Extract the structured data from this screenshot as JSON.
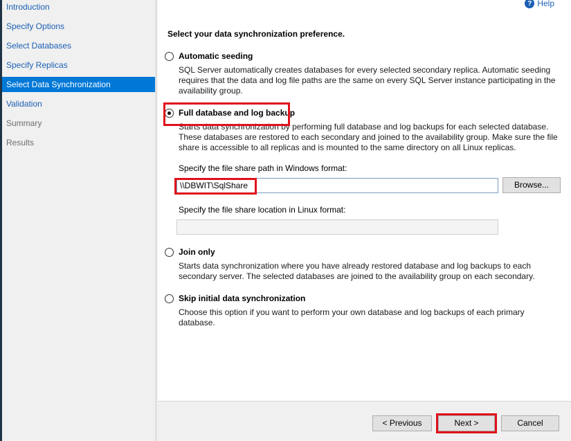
{
  "sidebar": {
    "items": [
      {
        "label": "Introduction",
        "state": "link"
      },
      {
        "label": "Specify Options",
        "state": "link"
      },
      {
        "label": "Select Databases",
        "state": "link"
      },
      {
        "label": "Specify Replicas",
        "state": "link"
      },
      {
        "label": "Select Data Synchronization",
        "state": "active"
      },
      {
        "label": "Validation",
        "state": "link"
      },
      {
        "label": "Summary",
        "state": "disabled"
      },
      {
        "label": "Results",
        "state": "disabled"
      }
    ]
  },
  "header": {
    "help_label": "Help",
    "help_icon": "help-icon"
  },
  "main": {
    "title": "Select your data synchronization preference.",
    "options": {
      "automatic": {
        "label": "Automatic seeding",
        "selected": false,
        "desc": "SQL Server automatically creates databases for every selected secondary replica. Automatic seeding requires that the data and log file paths are the same on every SQL Server instance participating in the availability group."
      },
      "full": {
        "label": "Full database and log backup",
        "selected": true,
        "desc": "Starts data synchronization by performing full database and log backups for each selected database. These databases are restored to each secondary and joined to the availability group. Make sure the file share is accessible to all replicas and is mounted to the same directory on all Linux replicas.",
        "windows_path_label": "Specify the file share path in Windows format:",
        "windows_path_value": "\\\\DBWIT\\SqlShare",
        "browse_label": "Browse...",
        "linux_path_label": "Specify the file share location in Linux format:",
        "linux_path_value": ""
      },
      "join": {
        "label": "Join only",
        "selected": false,
        "desc": "Starts data synchronization where you have already restored database and log backups to each secondary server. The selected databases are joined to the availability group on each secondary."
      },
      "skip": {
        "label": "Skip initial data synchronization",
        "selected": false,
        "desc": "Choose this option if you want to perform your own database and log backups of each primary database."
      }
    }
  },
  "footer": {
    "previous_label": "< Previous",
    "next_label": "Next >",
    "cancel_label": "Cancel"
  },
  "colors": {
    "accent": "#0078d7",
    "link": "#1a5fb4",
    "highlight": "#e0101a"
  }
}
